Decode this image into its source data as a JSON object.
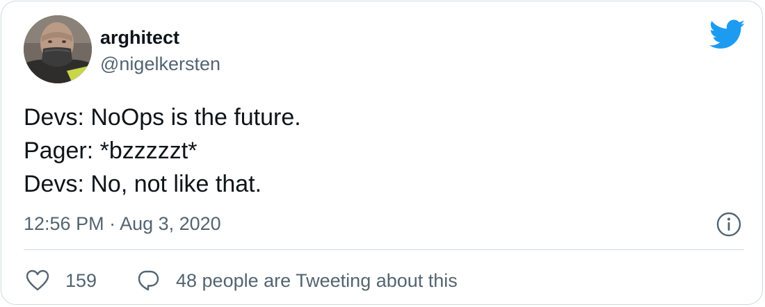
{
  "author": {
    "display_name": "arghitect",
    "handle": "@nigelkersten",
    "avatar_icon": "profile-photo"
  },
  "brand": {
    "logo_icon": "twitter-bird-icon",
    "color": "#1d9bf0"
  },
  "tweet": {
    "lines": [
      "Devs: NoOps is the future.",
      "Pager: *bzzzzzt*",
      "Devs: No, not like that."
    ],
    "timestamp": "12:56 PM · Aug 3, 2020"
  },
  "actions": {
    "like_icon": "heart-icon",
    "like_count": "159",
    "reply_icon": "speech-bubble-icon",
    "discussion_label": "48 people are Tweeting about this"
  },
  "info_icon": "info-icon",
  "colors": {
    "text_primary": "#0f1419",
    "text_secondary": "#536471",
    "border": "#cfd9de"
  }
}
